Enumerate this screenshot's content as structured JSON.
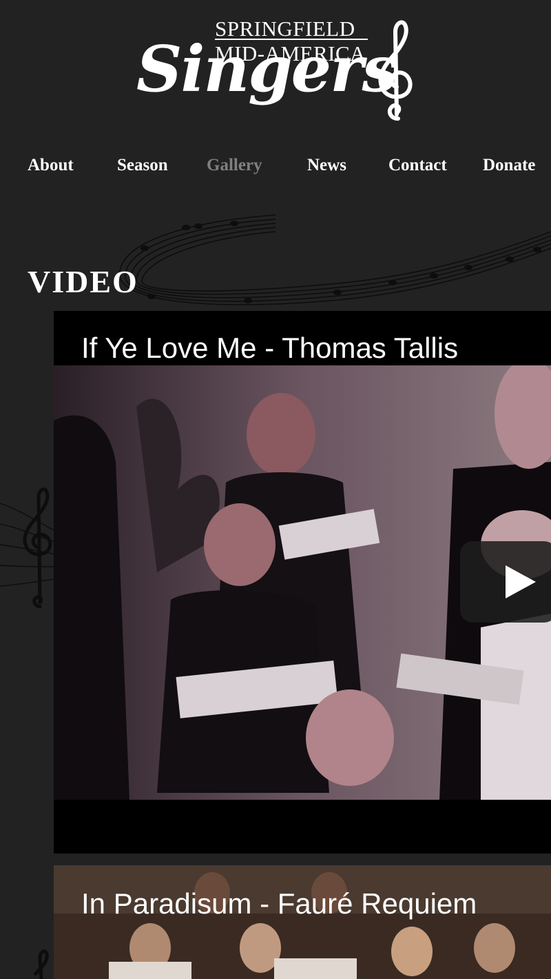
{
  "logo": {
    "line1": "SPRINGFIELD",
    "line2": "MID-AMERICA",
    "script": "Singers",
    "clef_icon": "treble-clef-icon"
  },
  "nav": {
    "items": [
      {
        "label": "About",
        "active": false
      },
      {
        "label": "Season",
        "active": false
      },
      {
        "label": "Gallery",
        "active": true
      },
      {
        "label": "News",
        "active": false
      },
      {
        "label": "Contact",
        "active": false
      },
      {
        "label": "Donate",
        "active": false
      }
    ]
  },
  "section": {
    "title": "VIDEO"
  },
  "videos": [
    {
      "title": "If Ye Love Me - Thomas Tallis",
      "play_icon": "play-icon"
    },
    {
      "title": "In Paradisum - Fauré Requiem"
    }
  ],
  "colors": {
    "background": "#222222",
    "nav_active": "#808080",
    "video_bg": "#000000",
    "text": "#ffffff"
  }
}
